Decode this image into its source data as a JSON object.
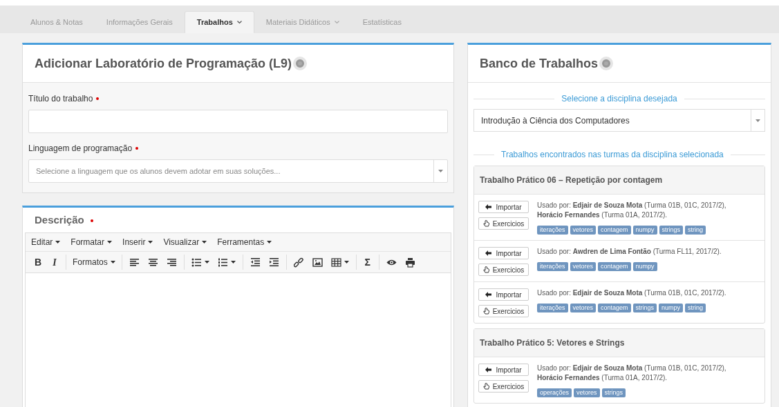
{
  "tabs": [
    {
      "label": "Alunos & Notas",
      "selected": false,
      "dropdown": false
    },
    {
      "label": "Informações Gerais",
      "selected": false,
      "dropdown": false
    },
    {
      "label": "Trabalhos",
      "selected": true,
      "dropdown": true
    },
    {
      "label": "Materiais Didáticos",
      "selected": false,
      "dropdown": true
    },
    {
      "label": "Estatísticas",
      "selected": false,
      "dropdown": false
    }
  ],
  "add_form": {
    "title": "Adicionar Laboratório de Programação (L9)",
    "fields": [
      {
        "kind": "text",
        "label": "Título do trabalho",
        "required": true
      },
      {
        "kind": "select",
        "label": "Linguagem de programação",
        "required": true,
        "placeholder": "Selecione a linguagem que os alunos devem adotar em suas soluções..."
      }
    ]
  },
  "description": {
    "title": "Descrição",
    "required": true,
    "menu": [
      "Editar",
      "Formatar",
      "Inserir",
      "Visualizar",
      "Ferramentas"
    ],
    "toolbar": [
      [
        {
          "kind": "bold",
          "label": "B"
        },
        {
          "kind": "italic",
          "label": "I"
        }
      ],
      [
        {
          "kind": "menu",
          "label": "Formatos"
        }
      ],
      [
        {
          "kind": "align-left"
        },
        {
          "kind": "align-center"
        },
        {
          "kind": "align-right"
        }
      ],
      [
        {
          "kind": "bullet-list"
        },
        {
          "kind": "numbered-list"
        }
      ],
      [
        {
          "kind": "outdent"
        },
        {
          "kind": "indent"
        }
      ],
      [
        {
          "kind": "link"
        },
        {
          "kind": "image"
        },
        {
          "kind": "table"
        }
      ],
      [
        {
          "kind": "symbol",
          "label": "Σ"
        }
      ],
      [
        {
          "kind": "eye"
        },
        {
          "kind": "print"
        }
      ]
    ]
  },
  "bank": {
    "title": "Banco de Trabalhos",
    "discipline_heading": "Selecione a disciplina desejada",
    "discipline": "Introdução à Ciência dos Computadores",
    "results_heading": "Trabalhos encontrados nas turmas da disciplina selecionada",
    "works": [
      {
        "title": "Trabalho Prático 06 – Repetição por contagem",
        "entries": [
          {
            "import": "Importar",
            "exercises": "Exercicios",
            "used_by": "Usado por: **Edjair de Souza Mota** (Turma 01B, 01C, 2017/2), **Horácio Fernandes** (Turma 01A, 2017/2).",
            "tags": [
              "iterações",
              "vetores",
              "contagem",
              "numpy",
              "strings",
              "string"
            ]
          },
          {
            "import": "Importar",
            "exercises": "Exercicios",
            "used_by": "Usado por: **Awdren de Lima Fontão** (Turma FL11, 2017/2).",
            "tags": [
              "iterações",
              "vetores",
              "contagem",
              "numpy"
            ]
          },
          {
            "import": "Importar",
            "exercises": "Exercicios",
            "used_by": "Usado por: **Edjair de Souza Mota** (Turma 01B, 01C, 2017/2).",
            "tags": [
              "iterações",
              "vetores",
              "contagem",
              "strings",
              "numpy",
              "string"
            ]
          }
        ]
      },
      {
        "title": "Trabalho Prático 5: Vetores e Strings",
        "entries": [
          {
            "import": "Importar",
            "exercises": "Exercicios",
            "used_by": "Usado por: **Edjair de Souza Mota** (Turma 01B, 01C, 2017/2), **Horácio Fernandes** (Turma 01A, 2017/2).",
            "tags": [
              "operações",
              "vetores",
              "strings"
            ]
          }
        ]
      }
    ]
  }
}
